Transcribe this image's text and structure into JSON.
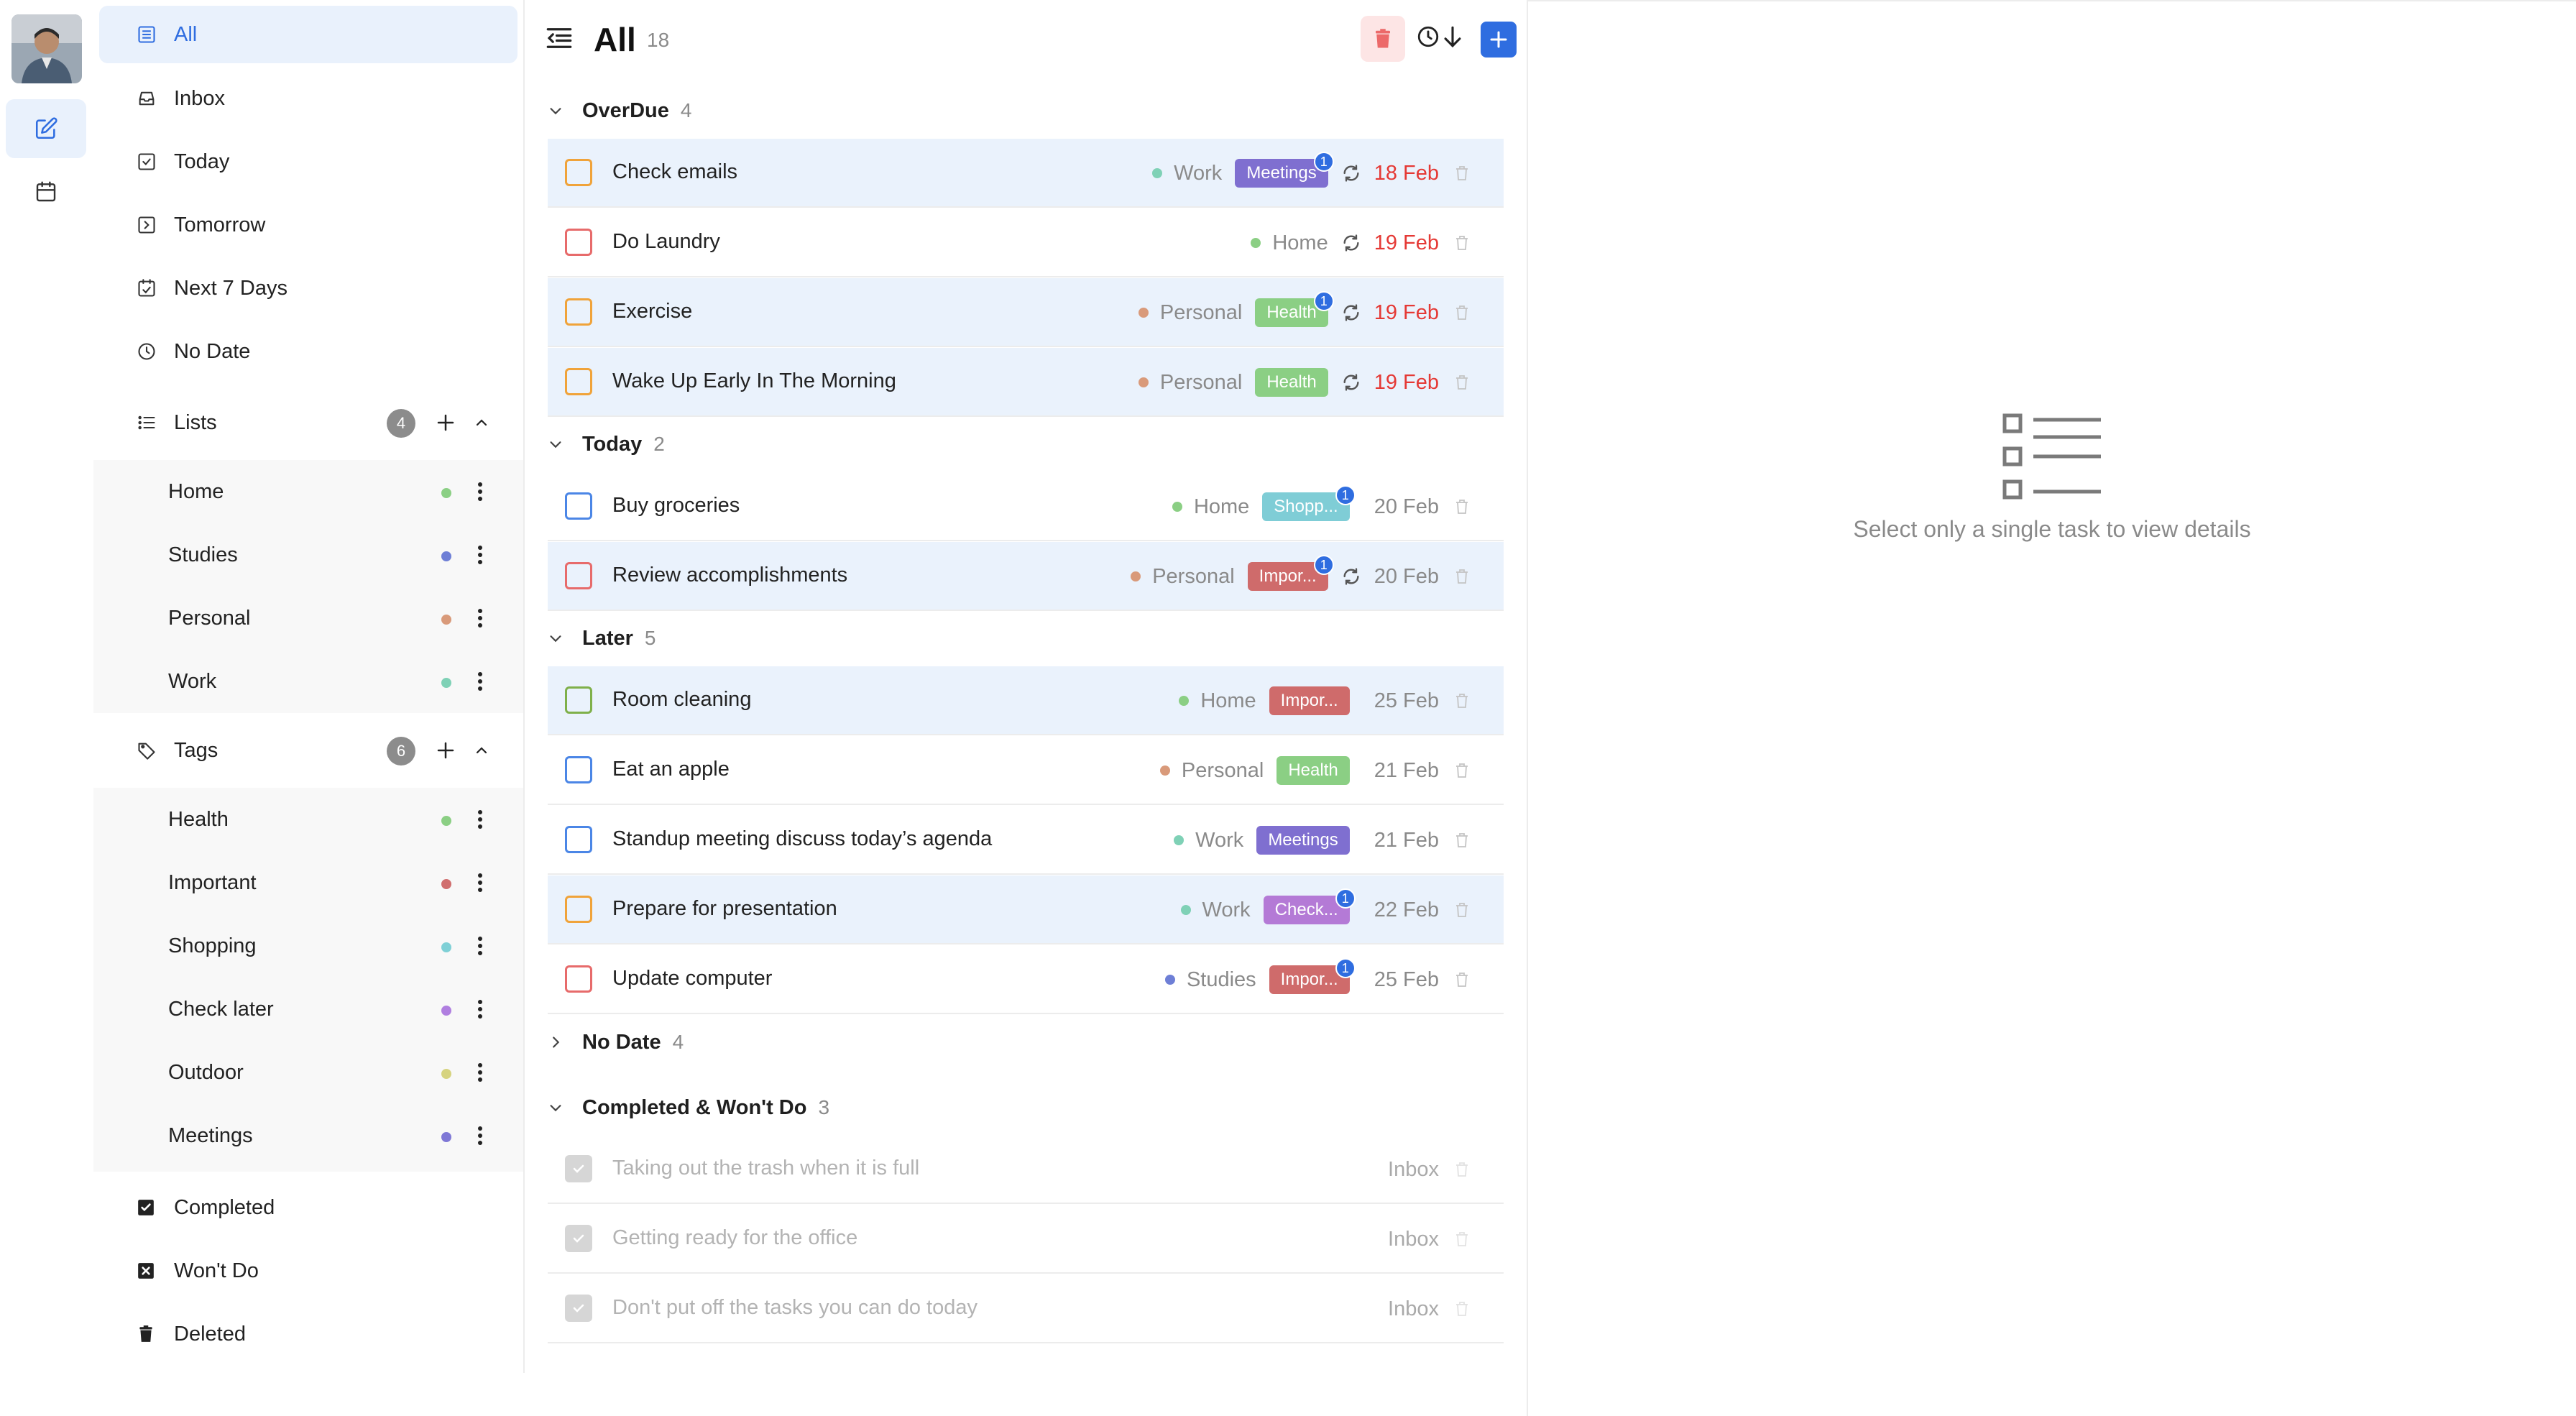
{
  "rail": {
    "avatar_icon": "user-avatar-photo",
    "items": [
      {
        "icon": "edit-note-icon",
        "active": true
      },
      {
        "icon": "calendar-icon",
        "active": false
      }
    ]
  },
  "sidebar": {
    "nav": [
      {
        "label": "All",
        "icon": "list-icon",
        "active": true
      },
      {
        "label": "Inbox",
        "icon": "inbox-icon"
      },
      {
        "label": "Today",
        "icon": "checkbox-icon"
      },
      {
        "label": "Tomorrow",
        "icon": "arrow-box-icon"
      },
      {
        "label": "Next 7 Days",
        "icon": "calendar-check-icon"
      },
      {
        "label": "No Date",
        "icon": "clock-icon"
      }
    ],
    "lists": {
      "label": "Lists",
      "count": "4",
      "items": [
        {
          "label": "Home",
          "color": "#8bcf84"
        },
        {
          "label": "Studies",
          "color": "#6e7fd6"
        },
        {
          "label": "Personal",
          "color": "#d99a7a"
        },
        {
          "label": "Work",
          "color": "#7fd1b6"
        }
      ]
    },
    "tags": {
      "label": "Tags",
      "count": "6",
      "items": [
        {
          "label": "Health",
          "color": "#8bcf84"
        },
        {
          "label": "Important",
          "color": "#d06e6e"
        },
        {
          "label": "Shopping",
          "color": "#7fd0d6"
        },
        {
          "label": "Check later",
          "color": "#b07fe0"
        },
        {
          "label": "Outdoor",
          "color": "#d6d37f"
        },
        {
          "label": "Meetings",
          "color": "#7f78d6"
        }
      ]
    },
    "bottom": [
      {
        "label": "Completed",
        "icon": "checked-box-icon"
      },
      {
        "label": "Won't Do",
        "icon": "x-box-icon"
      },
      {
        "label": "Deleted",
        "icon": "trash-icon"
      }
    ]
  },
  "main": {
    "title": "All",
    "count": "18",
    "colors": {
      "accent": "#2f6de0",
      "overdue": "#e53935"
    },
    "groups": [
      {
        "label": "OverDue",
        "count": "4",
        "expanded": true,
        "tasks": [
          {
            "title": "Check emails",
            "priority_color": "#f0a33a",
            "selected": true,
            "list": "Work",
            "list_color": "#7fd1b6",
            "tag": "Meetings",
            "tag_color": "#7f6fd0",
            "tag_badge": "1",
            "repeat": true,
            "date": "18 Feb",
            "overdue": true
          },
          {
            "title": "Do Laundry",
            "priority_color": "#e76b6b",
            "selected": false,
            "list": "Home",
            "list_color": "#8bcf84",
            "tag": "",
            "repeat": true,
            "date": "19 Feb",
            "overdue": true
          },
          {
            "title": "Exercise",
            "priority_color": "#f0a33a",
            "selected": true,
            "list": "Personal",
            "list_color": "#d99a7a",
            "tag": "Health",
            "tag_color": "#8bcf84",
            "tag_badge": "1",
            "repeat": true,
            "date": "19 Feb",
            "overdue": true
          },
          {
            "title": "Wake Up Early In The Morning",
            "priority_color": "#f0a33a",
            "selected": true,
            "list": "Personal",
            "list_color": "#d99a7a",
            "tag": "Health",
            "tag_color": "#8bcf84",
            "repeat": true,
            "date": "19 Feb",
            "overdue": true
          }
        ]
      },
      {
        "label": "Today",
        "count": "2",
        "expanded": true,
        "tasks": [
          {
            "title": "Buy groceries",
            "priority_color": "#4b86e6",
            "selected": false,
            "list": "Home",
            "list_color": "#8bcf84",
            "tag": "Shopp...",
            "tag_color": "#7fcdd6",
            "tag_badge": "1",
            "repeat": false,
            "date": "20 Feb",
            "overdue": false
          },
          {
            "title": "Review accomplishments",
            "priority_color": "#e76b6b",
            "selected": true,
            "list": "Personal",
            "list_color": "#d99a7a",
            "tag": "Impor...",
            "tag_color": "#cf6b6b",
            "tag_badge": "1",
            "repeat": true,
            "date": "20 Feb",
            "overdue": false
          }
        ]
      },
      {
        "label": "Later",
        "count": "5",
        "expanded": true,
        "tasks": [
          {
            "title": "Room cleaning",
            "priority_color": "#7fb04a",
            "selected": true,
            "list": "Home",
            "list_color": "#8bcf84",
            "tag": "Impor...",
            "tag_color": "#cf6b6b",
            "repeat": false,
            "date": "25 Feb",
            "overdue": false
          },
          {
            "title": "Eat an apple",
            "priority_color": "#4b86e6",
            "selected": false,
            "list": "Personal",
            "list_color": "#d99a7a",
            "tag": "Health",
            "tag_color": "#8bcf84",
            "repeat": false,
            "date": "21 Feb",
            "overdue": false
          },
          {
            "title": "Standup meeting discuss today’s agenda",
            "priority_color": "#4b86e6",
            "selected": false,
            "list": "Work",
            "list_color": "#7fd1b6",
            "tag": "Meetings",
            "tag_color": "#7f6fd0",
            "repeat": false,
            "date": "21 Feb",
            "overdue": false
          },
          {
            "title": "Prepare for presentation",
            "priority_color": "#f0a33a",
            "selected": true,
            "list": "Work",
            "list_color": "#7fd1b6",
            "tag": "Check...",
            "tag_color": "#b47ad6",
            "tag_badge": "1",
            "repeat": false,
            "date": "22 Feb",
            "overdue": false
          },
          {
            "title": "Update computer",
            "priority_color": "#e76b6b",
            "selected": false,
            "list": "Studies",
            "list_color": "#6e7fd6",
            "tag": "Impor...",
            "tag_color": "#cf6b6b",
            "tag_badge": "1",
            "repeat": false,
            "date": "25 Feb",
            "overdue": false
          }
        ]
      },
      {
        "label": "No Date",
        "count": "4",
        "expanded": false,
        "tasks": []
      },
      {
        "label": "Completed & Won't Do",
        "count": "3",
        "expanded": true,
        "tasks": [
          {
            "title": "Taking out the trash when it is full",
            "completed": true,
            "list": "Inbox"
          },
          {
            "title": "Getting ready for the office",
            "completed": true,
            "list": "Inbox"
          },
          {
            "title": "Don't put off the tasks you can do today",
            "completed": true,
            "list": "Inbox"
          }
        ]
      }
    ]
  },
  "detail": {
    "empty_icon": "list-icon",
    "empty_text": "Select only a single task to view details"
  }
}
